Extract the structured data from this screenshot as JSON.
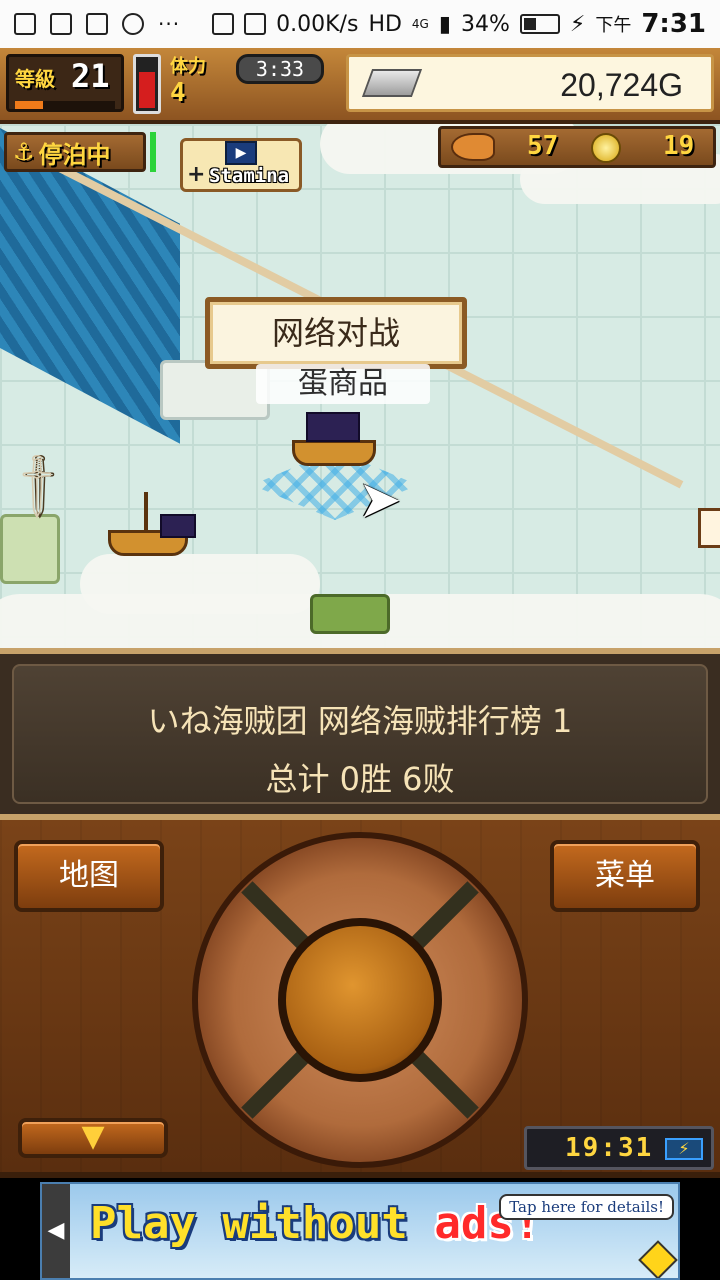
{
  "status_bar": {
    "speed": "0.00K/s",
    "network": "HD",
    "network_sub": "4G",
    "battery": "34%",
    "ampm": "下午",
    "time": "7:31",
    "ellipsis": "···"
  },
  "hud": {
    "level_label": "等級",
    "level_value": "21",
    "stamina_label": "体力",
    "stamina_value": "4",
    "timer": "3:33",
    "gold": "20,724G",
    "harbor_status": "停泊中",
    "stamina_button": "Stamina",
    "fish_count": "57",
    "coin_count": "19"
  },
  "map": {
    "popup_menu": "网络对战",
    "shop_label": "蛋商品"
  },
  "info": {
    "line1": "いね海贼团  网络海贼排行榜  1",
    "line2": "总计 0胜 6败"
  },
  "controls": {
    "map_button": "地图",
    "menu_button": "菜单",
    "down_button": "▼",
    "clock": "19:31",
    "battery_icon": "⚡"
  },
  "ad": {
    "text_main": "Play without ",
    "text_red": "ads!",
    "tap_details": "Tap here for details!",
    "arrow": "◀"
  }
}
